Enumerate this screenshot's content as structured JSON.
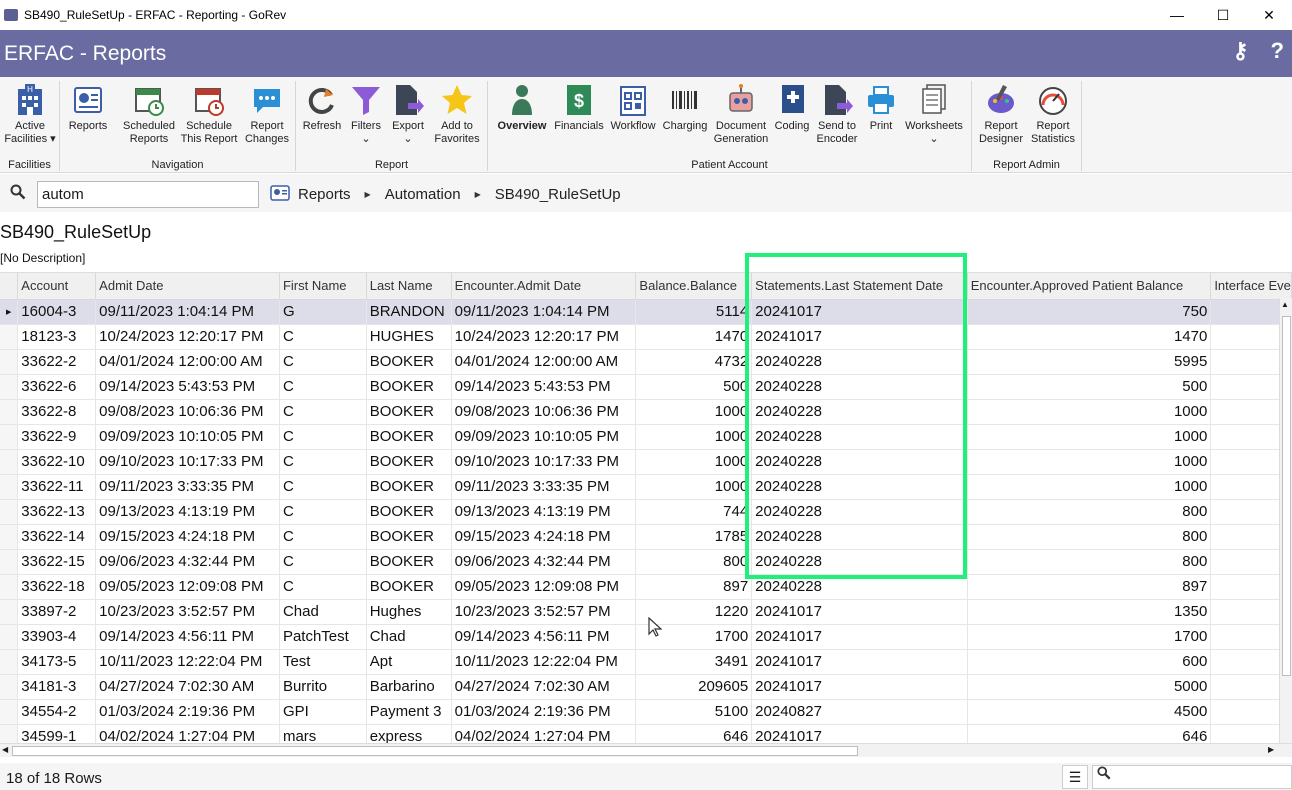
{
  "window": {
    "title": "SB490_RuleSetUp - ERFAC - Reporting - GoRev",
    "app_icon": "GoRev",
    "minimize": "—",
    "maximize": "☐",
    "close": "✕"
  },
  "header": {
    "title": "ERFAC - Reports",
    "accent": "#6a6ba0"
  },
  "ribbon": {
    "facilities": {
      "label": "Facilities",
      "active_facilities": "Active Facilities ▾"
    },
    "navigation": {
      "label": "Navigation",
      "reports": "Reports",
      "scheduled_reports": "Scheduled Reports",
      "schedule_this_report": "Schedule This Report",
      "report_changes": "Report Changes"
    },
    "report": {
      "label": "Report",
      "refresh": "Refresh",
      "filters": "Filters",
      "export": "Export",
      "add_to_favorites": "Add to Favorites"
    },
    "patient_account": {
      "label": "Patient Account",
      "overview": "Overview",
      "financials": "Financials",
      "workflow": "Workflow",
      "charging": "Charging",
      "document_generation": "Document Generation",
      "coding": "Coding",
      "send_to_encoder": "Send to Encoder",
      "print": "Print",
      "worksheets": "Worksheets"
    },
    "report_admin": {
      "label": "Report Admin",
      "report_designer": "Report Designer",
      "report_statistics": "Report Statistics"
    }
  },
  "search": {
    "value": "autom"
  },
  "breadcrumb": [
    "Reports",
    "Automation",
    "SB490_RuleSetUp"
  ],
  "report": {
    "title": "SB490_RuleSetUp",
    "description": "[No Description]"
  },
  "table": {
    "columns": [
      "Account",
      "Admit Date",
      "First Name",
      "Last Name",
      "Encounter.Admit Date",
      "Balance.Balance",
      "Statements.Last Statement Date",
      "Encounter.Approved Patient Balance",
      "Interface Eve"
    ],
    "rows": [
      [
        "16004-3",
        "09/11/2023 1:04:14 PM",
        "G",
        "BRANDON",
        "09/11/2023 1:04:14 PM",
        "5114",
        "20241017",
        "750"
      ],
      [
        "18123-3",
        "10/24/2023 12:20:17 PM",
        "C",
        "HUGHES",
        "10/24/2023 12:20:17 PM",
        "1470",
        "20241017",
        "1470"
      ],
      [
        "33622-2",
        "04/01/2024 12:00:00 AM",
        "C",
        "BOOKER",
        "04/01/2024 12:00:00 AM",
        "4732",
        "20240228",
        "5995"
      ],
      [
        "33622-6",
        "09/14/2023 5:43:53 PM",
        "C",
        "BOOKER",
        "09/14/2023 5:43:53 PM",
        "500",
        "20240228",
        "500"
      ],
      [
        "33622-8",
        "09/08/2023 10:06:36 PM",
        "C",
        "BOOKER",
        "09/08/2023 10:06:36 PM",
        "1000",
        "20240228",
        "1000"
      ],
      [
        "33622-9",
        "09/09/2023 10:10:05 PM",
        "C",
        "BOOKER",
        "09/09/2023 10:10:05 PM",
        "1000",
        "20240228",
        "1000"
      ],
      [
        "33622-10",
        "09/10/2023 10:17:33 PM",
        "C",
        "BOOKER",
        "09/10/2023 10:17:33 PM",
        "1000",
        "20240228",
        "1000"
      ],
      [
        "33622-11",
        "09/11/2023 3:33:35 PM",
        "C",
        "BOOKER",
        "09/11/2023 3:33:35 PM",
        "1000",
        "20240228",
        "1000"
      ],
      [
        "33622-13",
        "09/13/2023 4:13:19 PM",
        "C",
        "BOOKER",
        "09/13/2023 4:13:19 PM",
        "744",
        "20240228",
        "800"
      ],
      [
        "33622-14",
        "09/15/2023 4:24:18 PM",
        "C",
        "BOOKER",
        "09/15/2023 4:24:18 PM",
        "1785",
        "20240228",
        "800"
      ],
      [
        "33622-15",
        "09/06/2023 4:32:44 PM",
        "C",
        "BOOKER",
        "09/06/2023 4:32:44 PM",
        "800",
        "20240228",
        "800"
      ],
      [
        "33622-18",
        "09/05/2023 12:09:08 PM",
        "C",
        "BOOKER",
        "09/05/2023 12:09:08 PM",
        "897",
        "20240228",
        "897"
      ],
      [
        "33897-2",
        "10/23/2023 3:52:57 PM",
        "Chad",
        "Hughes",
        "10/23/2023 3:52:57 PM",
        "1220",
        "20241017",
        "1350"
      ],
      [
        "33903-4",
        "09/14/2023 4:56:11 PM",
        "PatchTest",
        "Chad",
        "09/14/2023 4:56:11 PM",
        "1700",
        "20241017",
        "1700"
      ],
      [
        "34173-5",
        "10/11/2023 12:22:04 PM",
        "Test",
        "Apt",
        "10/11/2023 12:22:04 PM",
        "3491",
        "20241017",
        "600"
      ],
      [
        "34181-3",
        "04/27/2024 7:02:30 AM",
        "Burrito",
        "Barbarino",
        "04/27/2024 7:02:30 AM",
        "209605",
        "20241017",
        "5000"
      ],
      [
        "34554-2",
        "01/03/2024 2:19:36 PM",
        "GPI",
        "Payment 3",
        "01/03/2024 2:19:36 PM",
        "5100",
        "20240827",
        "4500"
      ],
      [
        "34599-1",
        "04/02/2024 1:27:04 PM",
        "mars",
        "express",
        "04/02/2024 1:27:04 PM",
        "646",
        "20241017",
        "646"
      ]
    ]
  },
  "status": {
    "row_count": "18 of 18 Rows"
  },
  "highlight_color": "#1ef07a"
}
